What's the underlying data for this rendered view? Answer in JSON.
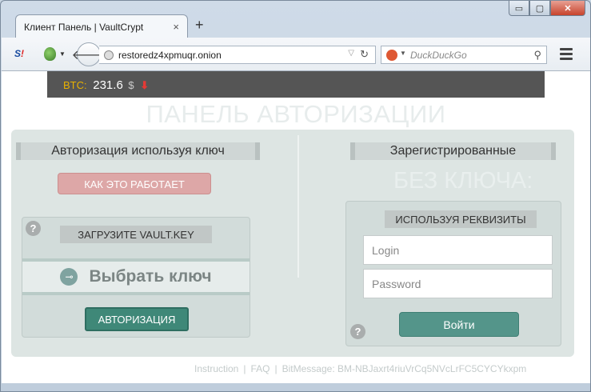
{
  "window": {
    "minimize": "▭",
    "maximize": "▢",
    "close": "✕"
  },
  "tab": {
    "title": "Клиент Панель | VaultCrypt",
    "close": "×",
    "new_tab": "+"
  },
  "toolbar": {
    "addon_badge_s": "S",
    "addon_badge_slash": "!",
    "url": "restoredz4xpmuqr.onion",
    "search_placeholder": "DuckDuckGo"
  },
  "ticker": {
    "btc_label": "BTC:",
    "price": "231.6",
    "currency": "$",
    "trend": "⬇"
  },
  "page": {
    "title": "ПАНЕЛЬ АВТОРИЗАЦИИ"
  },
  "left": {
    "heading": "Авторизация используя ключ",
    "how_it_works": "КАК ЭТО РАБОТАЕТ",
    "help": "?",
    "upload_label": "ЗАГРУЗИТЕ VAULT.KEY",
    "choose_key": "Выбрать ключ",
    "authorize": "АВТОРИЗАЦИЯ"
  },
  "right": {
    "heading": "Зарегистрированные",
    "subheading": "БЕЗ КЛЮЧА:",
    "help": "?",
    "creds_label": "ИСПОЛЬЗУЯ РЕКВИЗИТЫ",
    "login_placeholder": "Login",
    "password_placeholder": "Password",
    "submit": "Войти"
  },
  "footer": {
    "instruction": "Instruction",
    "faq": "FAQ",
    "bitmessage": "BitMessage: BM-NBJaxrt4riuVrCq5NVcLrFC5CYCYkxpm",
    "sep": "|"
  }
}
